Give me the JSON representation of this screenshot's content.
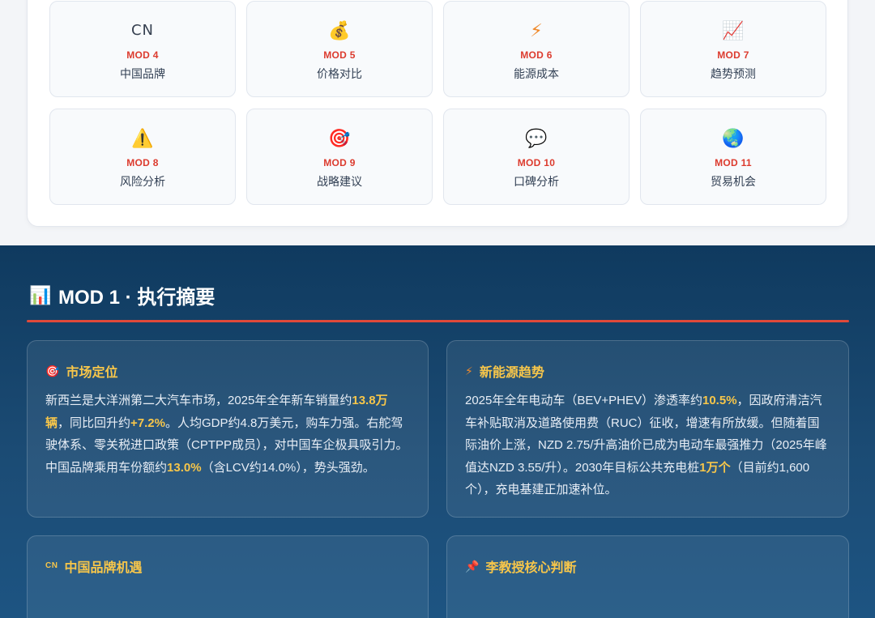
{
  "modules": [
    {
      "icon": "CN",
      "icon_name": "cn-text-icon",
      "code": "MOD 4",
      "name": "中国品牌"
    },
    {
      "icon": "💰",
      "icon_name": "money-bag-icon",
      "code": "MOD 5",
      "name": "价格对比"
    },
    {
      "icon": "⚡",
      "icon_name": "lightning-icon",
      "code": "MOD 6",
      "name": "能源成本"
    },
    {
      "icon": "📈",
      "icon_name": "trend-chart-icon",
      "code": "MOD 7",
      "name": "趋势预测"
    },
    {
      "icon": "⚠️",
      "icon_name": "warning-icon",
      "code": "MOD 8",
      "name": "风险分析"
    },
    {
      "icon": "🎯",
      "icon_name": "target-icon",
      "code": "MOD 9",
      "name": "战略建议"
    },
    {
      "icon": "💬",
      "icon_name": "speech-bubble-icon",
      "code": "MOD 10",
      "name": "口碑分析"
    },
    {
      "icon": "🌏",
      "icon_name": "globe-icon",
      "code": "MOD 11",
      "name": "贸易机会"
    }
  ],
  "section": {
    "icon": "📊",
    "title": "MOD 1 · 执行摘要"
  },
  "cards": {
    "market": {
      "icon": "🎯",
      "title": "市场定位",
      "t1": "新西兰是大洋洲第二大汽车市场，2025年全年新车销量约",
      "h1": "13.8万辆",
      "t2": "，同比回升约",
      "h2": "+7.2%",
      "t3": "。人均GDP约4.8万美元，购车力强。右舵驾驶体系、零关税进口政策（CPTPP成员），对中国车企极具吸引力。中国品牌乘用车份额约",
      "h3": "13.0%",
      "t4": "（含LCV约14.0%），势头强劲。"
    },
    "nev": {
      "icon": "⚡",
      "title": "新能源趋势",
      "t1": "2025年全年电动车（BEV+PHEV）渗透率约",
      "h1": "10.5%",
      "t2": "，因政府清洁汽车补贴取消及道路使用费（RUC）征收，增速有所放缓。但随着国际油价上涨，NZD 2.75/升高油价已成为电动车最强推力（2025年峰值达NZD 3.55/升）。2030年目标公共充电桩",
      "h2": "1万个",
      "t3": "（目前约1,600个），充电基建正加速补位。"
    },
    "china": {
      "icon": "CN",
      "title": "中国品牌机遇"
    },
    "professor": {
      "icon": "📌",
      "title": "李教授核心判断"
    }
  },
  "colors": {
    "accent_red": "#dc3b2e",
    "highlight_yellow": "#f7c64a",
    "dark_bg": "#1b4b74"
  }
}
